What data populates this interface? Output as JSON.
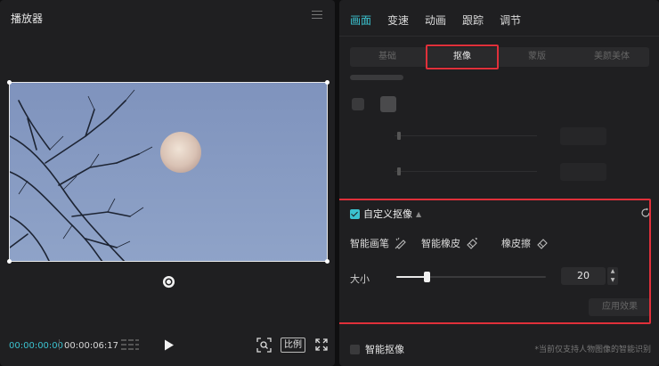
{
  "player": {
    "title": "播放器",
    "timecode_current": "00:00:00:00",
    "timecode_total": "00:00:06:17",
    "ratio_label": "比例"
  },
  "main_tabs": [
    {
      "label": "画面",
      "active": true
    },
    {
      "label": "变速",
      "active": false
    },
    {
      "label": "动画",
      "active": false
    },
    {
      "label": "跟踪",
      "active": false
    },
    {
      "label": "调节",
      "active": false
    }
  ],
  "sub_tabs": [
    {
      "label": "基础",
      "active": false
    },
    {
      "label": "抠像",
      "active": true
    },
    {
      "label": "蒙版",
      "active": false
    },
    {
      "label": "美颜美体",
      "active": false
    }
  ],
  "custom_cutout": {
    "title": "自定义抠像",
    "checked": true,
    "tools": [
      {
        "label": "智能画笔",
        "icon": "smart-brush-icon"
      },
      {
        "label": "智能橡皮",
        "icon": "smart-eraser-icon"
      },
      {
        "label": "橡皮擦",
        "icon": "eraser-icon"
      }
    ],
    "size_label": "大小",
    "size_value": "20",
    "size_fraction": 0.2,
    "apply_label": "应用效果"
  },
  "smart_cutout": {
    "label": "智能抠像",
    "checked": false,
    "note": "*当前仅支持人物图像的智能识别"
  },
  "colors": {
    "accent": "#3bc2cf",
    "highlight": "#e0303a",
    "panel": "#1f1f21"
  }
}
